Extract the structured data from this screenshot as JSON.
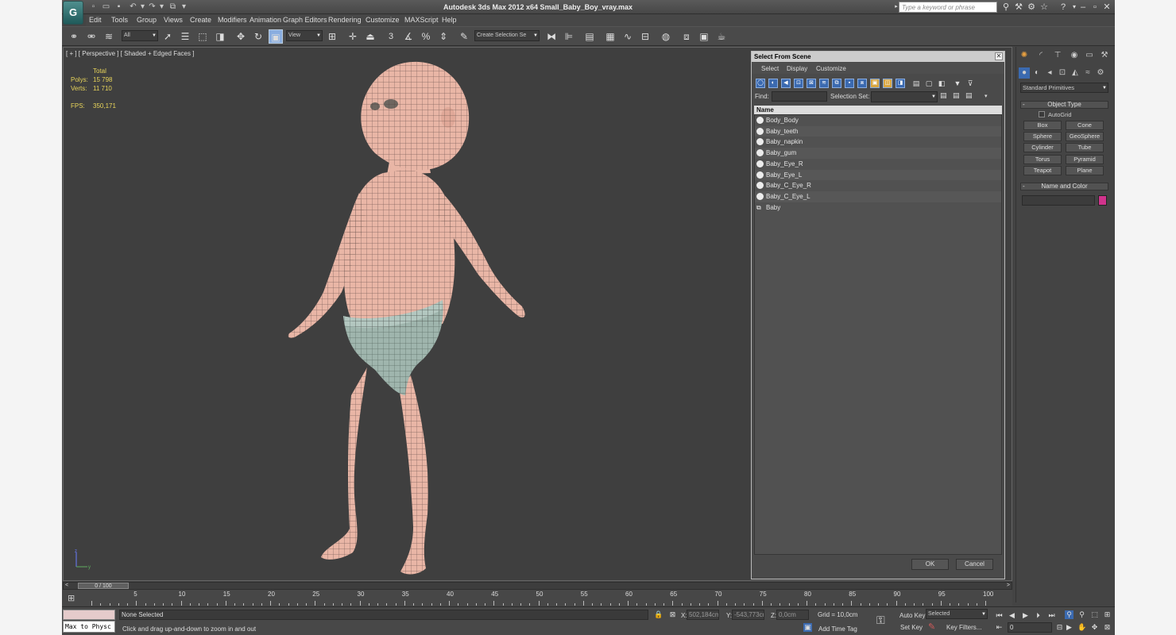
{
  "app": {
    "title": "Autodesk 3ds Max  2012 x64     Small_Baby_Boy_vray.max",
    "logo": "3ds-max-logo",
    "search_placeholder": "Type a keyword or phrase"
  },
  "menu": [
    "Edit",
    "Tools",
    "Group",
    "Views",
    "Create",
    "Modifiers",
    "Animation",
    "Graph Editors",
    "Rendering",
    "Customize",
    "MAXScript",
    "Help"
  ],
  "toolbar": {
    "filter_value": "All",
    "ref_coord_value": "View",
    "named_selection_value": "Create Selection Se",
    "snap_label": "3"
  },
  "viewport": {
    "label": "[ + ] [ Perspective ] [ Shaded + Edged Faces ]",
    "stats": {
      "total_label": "Total",
      "polys_label": "Polys:",
      "polys_value": "15 798",
      "verts_label": "Verts:",
      "verts_value": "11 710",
      "fps_label": "FPS:",
      "fps_value": "350,171"
    }
  },
  "dialog": {
    "title": "Select From Scene",
    "menus": [
      "Select",
      "Display",
      "Customize"
    ],
    "find_label": "Find:",
    "selection_set_label": "Selection Set:",
    "column_header": "Name",
    "items": [
      {
        "name": "Body_Body",
        "type": "geometry"
      },
      {
        "name": "Baby_teeth",
        "type": "geometry"
      },
      {
        "name": "Baby_napkin",
        "type": "geometry"
      },
      {
        "name": "Baby_gum",
        "type": "geometry"
      },
      {
        "name": "Baby_Eye_R",
        "type": "geometry"
      },
      {
        "name": "Baby_Eye_L",
        "type": "geometry"
      },
      {
        "name": "Baby_C_Eye_R",
        "type": "geometry"
      },
      {
        "name": "Baby_C_Eye_L",
        "type": "geometry"
      },
      {
        "name": "Baby",
        "type": "group"
      }
    ],
    "ok_label": "OK",
    "cancel_label": "Cancel"
  },
  "command_panel": {
    "category_value": "Standard Primitives",
    "object_type_header": "Object Type",
    "autogrid_label": "AutoGrid",
    "primitives": [
      "Box",
      "Cone",
      "Sphere",
      "GeoSphere",
      "Cylinder",
      "Tube",
      "Torus",
      "Pyramid",
      "Teapot",
      "Plane"
    ],
    "name_color_header": "Name and Color",
    "object_color": "#d0338c"
  },
  "timeline": {
    "frame_display": "0 / 100",
    "ticks": [
      "0",
      "5",
      "10",
      "15",
      "20",
      "25",
      "30",
      "35",
      "40",
      "45",
      "50",
      "55",
      "60",
      "65",
      "70",
      "75",
      "80",
      "85",
      "90",
      "95",
      "100"
    ]
  },
  "status": {
    "maxscript_listener": "Max to Physc",
    "selection_status": "None Selected",
    "prompt": "Click and drag up-and-down to zoom in and out",
    "x_label": "X:",
    "x_value": "502,184cm",
    "y_label": "Y:",
    "y_value": "-543,773cm",
    "z_label": "Z:",
    "z_value": "0,0cm",
    "grid": "Grid = 10,0cm",
    "add_time_tag": "Add Time Tag",
    "auto_key": "Auto Key",
    "set_key": "Set Key",
    "key_mode_value": "Selected",
    "key_filters": "Key Filters...",
    "current_frame": "0"
  },
  "colors": {
    "ui_bg": "#444444",
    "viewport_bg": "#3f3f3f",
    "stats_text": "#e8d45a",
    "skin": "#e9b6a6",
    "diaper": "#9fb5ad",
    "selection_blue": "#3b6ab0"
  }
}
